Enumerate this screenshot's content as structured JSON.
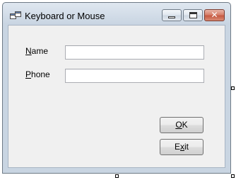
{
  "window": {
    "title": "Keyboard or Mouse",
    "icon": "form-icon",
    "caption_buttons": {
      "minimize_icon": "minimize-icon",
      "maximize_icon": "maximize-icon",
      "close_icon": "close-icon",
      "close_glyph": "✕"
    }
  },
  "form": {
    "name_label": {
      "pre": "",
      "accel": "N",
      "post": "ame"
    },
    "name_value": "",
    "phone_label": {
      "pre": "",
      "accel": "P",
      "post": "hone"
    },
    "phone_value": "",
    "ok_button": {
      "pre": "",
      "accel": "O",
      "post": "K"
    },
    "exit_button": {
      "pre": "E",
      "accel": "x",
      "post": "it"
    }
  },
  "colors": {
    "client_background": "#f0f0f0",
    "frame": "#c9d5e2",
    "close_button": "#c65a43"
  }
}
